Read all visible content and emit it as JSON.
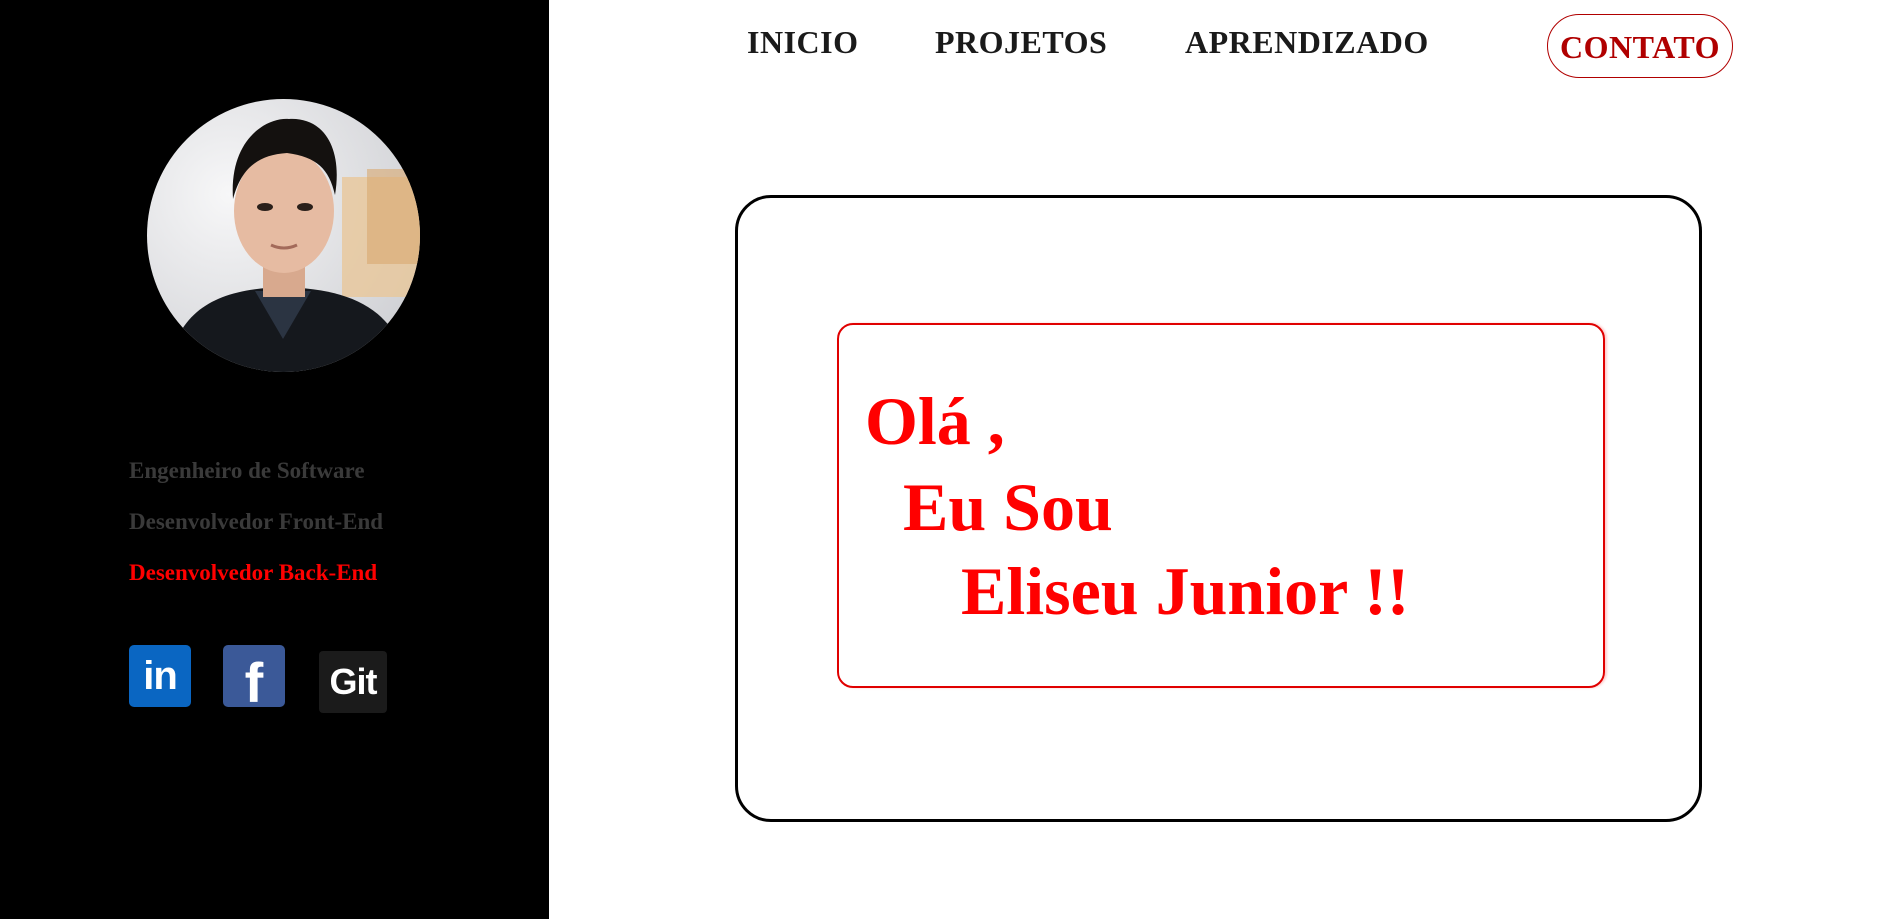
{
  "sidebar": {
    "avatar_alt": "profile photo",
    "roles": [
      "Engenheiro de Software",
      "Desenvolvedor Front-End",
      "Desenvolvedor Back-End"
    ],
    "active_role_color": "#ff0000",
    "social": {
      "linkedin_label": "in",
      "facebook_label": "f",
      "github_label": "Git",
      "icons": [
        "linkedin-icon",
        "facebook-icon",
        "github-icon"
      ]
    }
  },
  "nav": {
    "items": [
      "INICIO",
      "PROJETOS",
      "APRENDIZADO"
    ],
    "contact": "CONTATO",
    "contact_color": "#b00000"
  },
  "hero": {
    "line1": "Olá ,",
    "line2": "Eu Sou",
    "line3": "Eliseu Junior !!",
    "accent": "#ff0000"
  }
}
